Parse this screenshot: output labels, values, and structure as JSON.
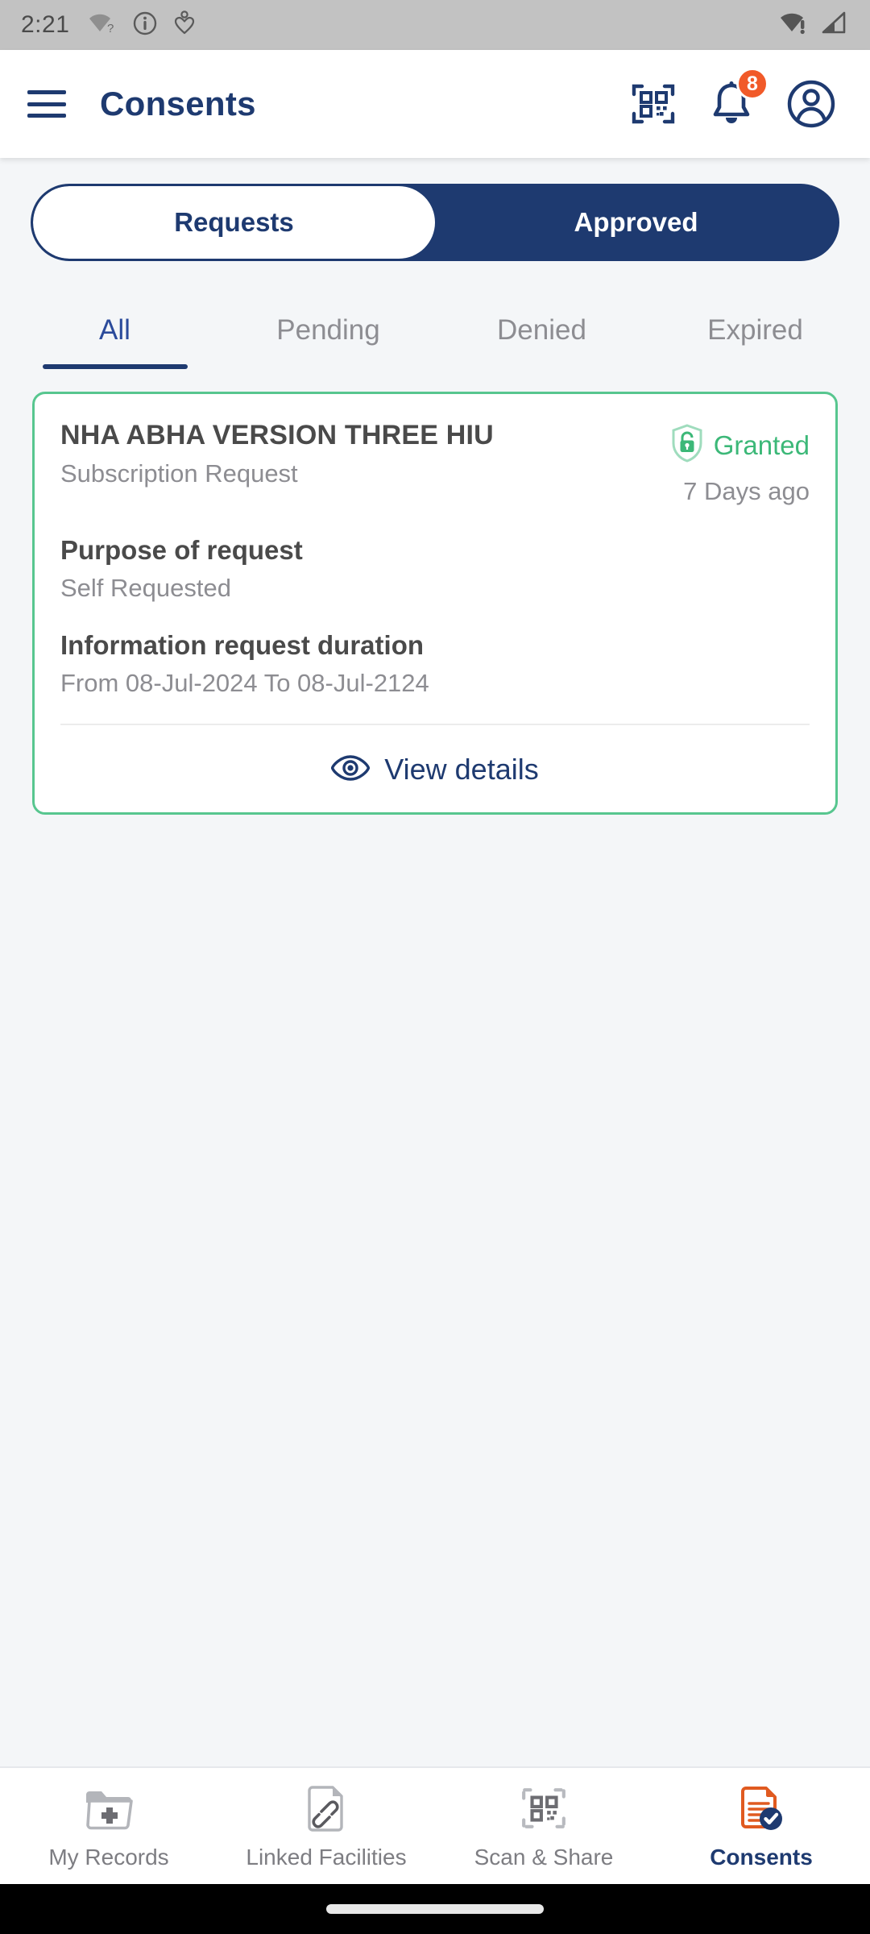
{
  "status_bar": {
    "time": "2:21",
    "left_icons": [
      "wifi-question-icon",
      "info-circle-icon",
      "heart-person-icon"
    ],
    "right_icons": [
      "wifi-alert-icon",
      "cellular-signal-icon"
    ]
  },
  "header": {
    "menu_icon": "hamburger-menu-icon",
    "title": "Consents",
    "scan_icon": "qr-scan-icon",
    "notifications_icon": "bell-icon",
    "notifications_count": "8",
    "profile_icon": "account-circle-icon"
  },
  "segmented_control": {
    "options": [
      {
        "label": "Requests",
        "selected": false
      },
      {
        "label": "Approved",
        "selected": true
      }
    ]
  },
  "tabs": [
    {
      "label": "All",
      "active": true
    },
    {
      "label": "Pending",
      "active": false
    },
    {
      "label": "Denied",
      "active": false
    },
    {
      "label": "Expired",
      "active": false
    }
  ],
  "consent_card": {
    "title": "NHA ABHA VERSION THREE HIU",
    "subtitle": "Subscription Request",
    "status_icon": "shield-lock-icon",
    "status": "Granted",
    "time_ago": "7 Days ago",
    "purpose_label": "Purpose of request",
    "purpose_value": "Self Requested",
    "duration_label": "Information request duration",
    "duration_value": "From 08-Jul-2024 To 08-Jul-2124",
    "view_details_icon": "eye-icon",
    "view_details_label": "View details"
  },
  "bottom_nav": [
    {
      "label": "My Records",
      "icon": "folder-plus-icon",
      "active": false
    },
    {
      "label": "Linked Facilities",
      "icon": "document-link-icon",
      "active": false
    },
    {
      "label": "Scan & Share",
      "icon": "qr-scan-icon",
      "active": false
    },
    {
      "label": "Consents",
      "icon": "document-check-icon",
      "active": true
    }
  ],
  "colors": {
    "brand_navy": "#1e3a70",
    "accent_orange": "#f15a29",
    "status_green": "#3cb878",
    "card_border_green": "#57c68f",
    "page_background": "#f4f6f8",
    "muted_text": "#8d8d92"
  }
}
